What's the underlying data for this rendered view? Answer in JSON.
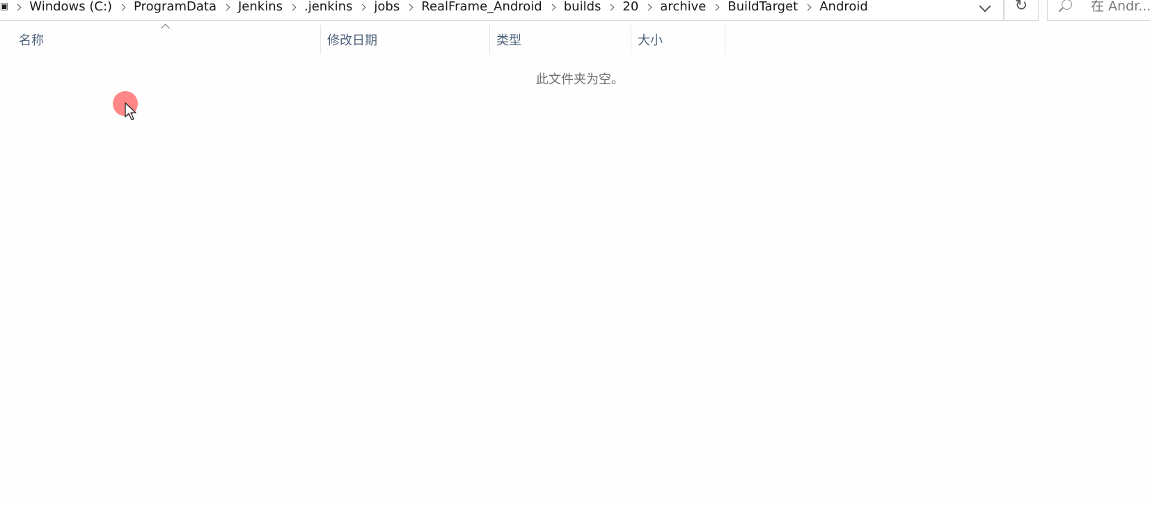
{
  "address_bar": {
    "crumbs": [
      "Windows (C:)",
      "ProgramData",
      "Jenkins",
      ".jenkins",
      "jobs",
      "RealFrame_Android",
      "builds",
      "20",
      "archive",
      "BuildTarget",
      "Android"
    ]
  },
  "search": {
    "placeholder": "在 Andr..."
  },
  "columns": {
    "name": "名称",
    "modified": "修改日期",
    "type": "类型",
    "size": "大小"
  },
  "content": {
    "empty_message": "此文件夹为空。"
  },
  "icons": {
    "pc": "pc-icon",
    "separator": "chevron-right-icon",
    "dropdown": "chevron-down-icon",
    "refresh": "refresh-icon",
    "search": "search-icon",
    "sort": "sort-ascending-icon",
    "cursor": "mouse-cursor-icon"
  },
  "colors": {
    "header_text": "#4c607a",
    "cursor_highlight": "#ff7a7a"
  }
}
